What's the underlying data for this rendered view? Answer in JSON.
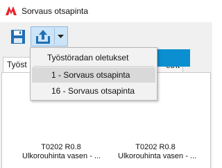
{
  "window": {
    "title": "Sorvaus otsapinta"
  },
  "colors": {
    "logo": "#e8222b",
    "accent": "#1f6fb5",
    "tool_body": "#0b8fd0",
    "tool_tip": "#f2d600"
  },
  "toolbar": {
    "save_icon": "save-icon",
    "export_icon": "export-icon"
  },
  "tabs": [
    {
      "label": "Työst"
    },
    {
      "label": "etrit"
    }
  ],
  "menu": {
    "header": "Työstöradan oletukset",
    "items": [
      {
        "label": "1 - Sorvaus otsapinta",
        "highlighted": true
      },
      {
        "label": "16 - Sorvaus otsapinta",
        "highlighted": false
      }
    ]
  },
  "tools": [
    {
      "name": "T0202 R0.8",
      "description": "Ulkorouhinta vasen - ..."
    },
    {
      "name": "T0202 R0.8",
      "description": "Ulkorouhinta vasen - ..."
    }
  ]
}
